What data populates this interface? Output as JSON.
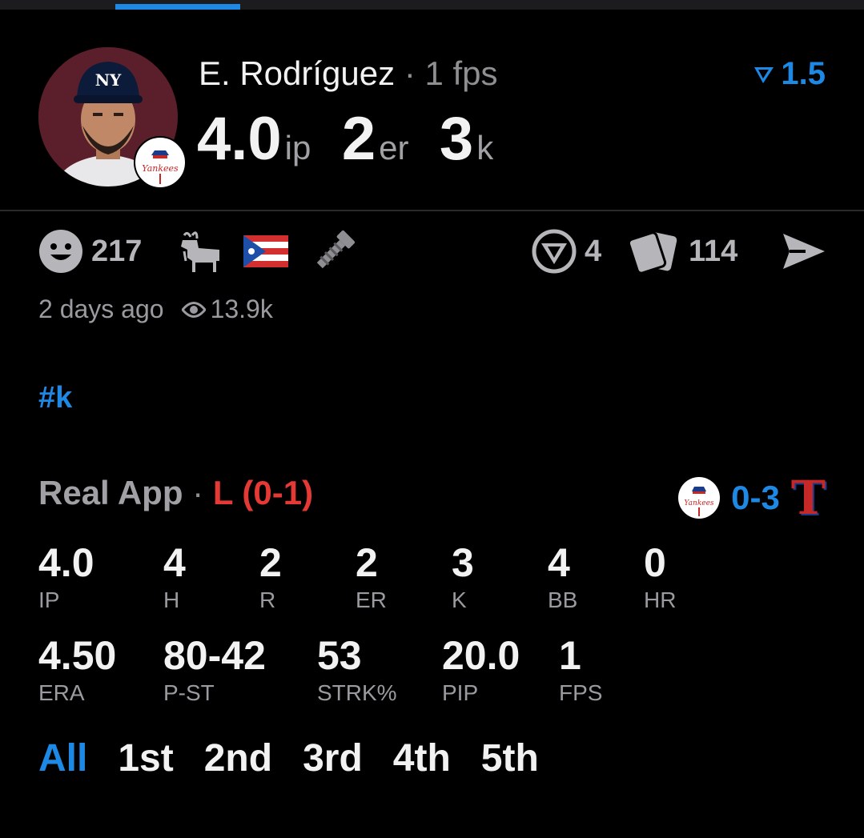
{
  "player": {
    "name": "E. Rodríguez",
    "separator": "·",
    "fps": "1 fps",
    "statline": [
      {
        "value": "4.0",
        "unit": "ip"
      },
      {
        "value": "2",
        "unit": "er"
      },
      {
        "value": "3",
        "unit": "k"
      }
    ],
    "rating": "1.5",
    "team_color": "#5a1f2a"
  },
  "actions": {
    "reactions_count": "217",
    "votes_count": "4",
    "cards_count": "114",
    "icons": [
      "smiley-icon",
      "goat-icon",
      "puerto-rico-flag-icon",
      "bolt-icon",
      "vote-icon",
      "cards-icon",
      "share-icon"
    ]
  },
  "meta": {
    "time_ago": "2 days ago",
    "views": "13.9k"
  },
  "hashtag": "#k",
  "game": {
    "app": "Real App",
    "separator": "·",
    "result": "L (0-1)",
    "score": "0-3",
    "away_logo_letter": "T"
  },
  "stats_row1": [
    {
      "value": "4.0",
      "label": "IP"
    },
    {
      "value": "4",
      "label": "H"
    },
    {
      "value": "2",
      "label": "R"
    },
    {
      "value": "2",
      "label": "ER"
    },
    {
      "value": "3",
      "label": "K"
    },
    {
      "value": "4",
      "label": "BB"
    },
    {
      "value": "0",
      "label": "HR"
    }
  ],
  "stats_row2": [
    {
      "value": "4.50",
      "label": "ERA"
    },
    {
      "value": "80-42",
      "label": "P-ST"
    },
    {
      "value": "53",
      "label": "STRK%"
    },
    {
      "value": "20.0",
      "label": "PIP"
    },
    {
      "value": "1",
      "label": "FPS"
    }
  ],
  "innings_tabs": [
    "All",
    "1st",
    "2nd",
    "3rd",
    "4th",
    "5th"
  ],
  "colors": {
    "accent": "#1e88e5",
    "loss": "#e53935",
    "muted": "#9a9aa0"
  }
}
